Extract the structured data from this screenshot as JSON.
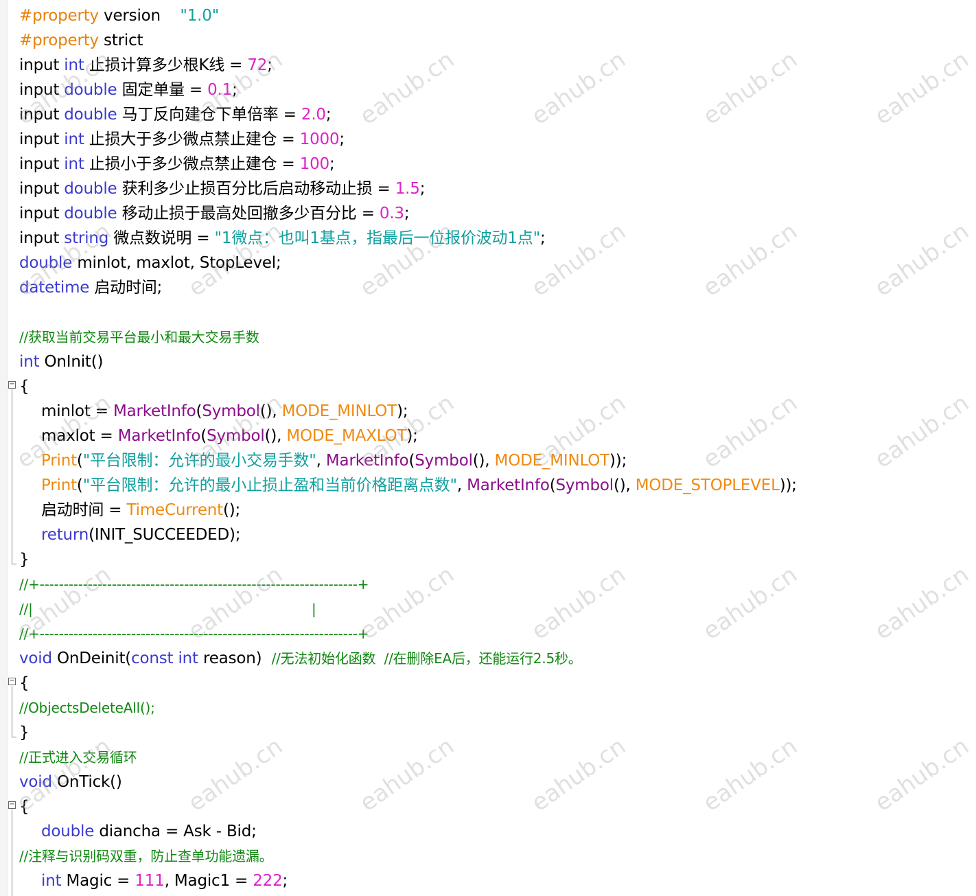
{
  "editor": {
    "watermark": "eahub.cn",
    "lines": [
      [
        {
          "t": "#property",
          "c": "pre"
        },
        {
          "t": " version    ",
          "c": "txt"
        },
        {
          "t": "\"1.0\"",
          "c": "str"
        }
      ],
      [
        {
          "t": "#property",
          "c": "pre"
        },
        {
          "t": " strict",
          "c": "txt"
        }
      ],
      [
        {
          "t": "input ",
          "c": "txt"
        },
        {
          "t": "int",
          "c": "kw"
        },
        {
          "t": " 止损计算多少根K线 = ",
          "c": "txt"
        },
        {
          "t": "72",
          "c": "num"
        },
        {
          "t": ";",
          "c": "txt"
        }
      ],
      [
        {
          "t": "input ",
          "c": "txt"
        },
        {
          "t": "double",
          "c": "kw"
        },
        {
          "t": " 固定单量 = ",
          "c": "txt"
        },
        {
          "t": "0.1",
          "c": "num"
        },
        {
          "t": ";",
          "c": "txt"
        }
      ],
      [
        {
          "t": "input ",
          "c": "txt"
        },
        {
          "t": "double",
          "c": "kw"
        },
        {
          "t": " 马丁反向建仓下单倍率 = ",
          "c": "txt"
        },
        {
          "t": "2.0",
          "c": "num"
        },
        {
          "t": ";",
          "c": "txt"
        }
      ],
      [
        {
          "t": "input ",
          "c": "txt"
        },
        {
          "t": "int",
          "c": "kw"
        },
        {
          "t": " 止损大于多少微点禁止建仓 = ",
          "c": "txt"
        },
        {
          "t": "1000",
          "c": "num"
        },
        {
          "t": ";",
          "c": "txt"
        }
      ],
      [
        {
          "t": "input ",
          "c": "txt"
        },
        {
          "t": "int",
          "c": "kw"
        },
        {
          "t": " 止损小于多少微点禁止建仓 = ",
          "c": "txt"
        },
        {
          "t": "100",
          "c": "num"
        },
        {
          "t": ";",
          "c": "txt"
        }
      ],
      [
        {
          "t": "input ",
          "c": "txt"
        },
        {
          "t": "double",
          "c": "kw"
        },
        {
          "t": " 获利多少止损百分比后启动移动止损 = ",
          "c": "txt"
        },
        {
          "t": "1.5",
          "c": "num"
        },
        {
          "t": ";",
          "c": "txt"
        }
      ],
      [
        {
          "t": "input ",
          "c": "txt"
        },
        {
          "t": "double",
          "c": "kw"
        },
        {
          "t": " 移动止损于最高处回撤多少百分比 = ",
          "c": "txt"
        },
        {
          "t": "0.3",
          "c": "num"
        },
        {
          "t": ";",
          "c": "txt"
        }
      ],
      [
        {
          "t": "input ",
          "c": "txt"
        },
        {
          "t": "string",
          "c": "kw"
        },
        {
          "t": " 微点数说明 = ",
          "c": "txt"
        },
        {
          "t": "\"1微点：也叫1基点，指最后一位报价波动1点\"",
          "c": "str"
        },
        {
          "t": ";",
          "c": "txt"
        }
      ],
      [
        {
          "t": "double",
          "c": "kw"
        },
        {
          "t": " minlot, maxlot, StopLevel;",
          "c": "txt"
        }
      ],
      [
        {
          "t": "datetime",
          "c": "kw"
        },
        {
          "t": " 启动时间;",
          "c": "txt"
        }
      ],
      [],
      [
        {
          "t": "//获取当前交易平台最小和最大交易手数",
          "c": "cmt",
          "small": true
        }
      ],
      [
        {
          "t": "int",
          "c": "kw"
        },
        {
          "t": " OnInit()",
          "c": "txt"
        }
      ],
      [
        {
          "t": "{",
          "c": "txt"
        }
      ],
      [
        {
          "t": "minlot = ",
          "c": "txt",
          "indent": true
        },
        {
          "t": "MarketInfo",
          "c": "fn"
        },
        {
          "t": "(",
          "c": "txt"
        },
        {
          "t": "Symbol",
          "c": "fn"
        },
        {
          "t": "(), ",
          "c": "txt"
        },
        {
          "t": "MODE_MINLOT",
          "c": "org"
        },
        {
          "t": ");",
          "c": "txt"
        }
      ],
      [
        {
          "t": "maxlot = ",
          "c": "txt",
          "indent": true
        },
        {
          "t": "MarketInfo",
          "c": "fn"
        },
        {
          "t": "(",
          "c": "txt"
        },
        {
          "t": "Symbol",
          "c": "fn"
        },
        {
          "t": "(), ",
          "c": "txt"
        },
        {
          "t": "MODE_MAXLOT",
          "c": "org"
        },
        {
          "t": ");",
          "c": "txt"
        }
      ],
      [
        {
          "t": "Print",
          "c": "org",
          "indent": true
        },
        {
          "t": "(",
          "c": "txt"
        },
        {
          "t": "\"平台限制：允许的最小交易手数\"",
          "c": "str"
        },
        {
          "t": ", ",
          "c": "txt"
        },
        {
          "t": "MarketInfo",
          "c": "fn"
        },
        {
          "t": "(",
          "c": "txt"
        },
        {
          "t": "Symbol",
          "c": "fn"
        },
        {
          "t": "(), ",
          "c": "txt"
        },
        {
          "t": "MODE_MINLOT",
          "c": "org"
        },
        {
          "t": "));",
          "c": "txt"
        }
      ],
      [
        {
          "t": "Print",
          "c": "org",
          "indent": true
        },
        {
          "t": "(",
          "c": "txt"
        },
        {
          "t": "\"平台限制：允许的最小止损止盈和当前价格距离点数\"",
          "c": "str"
        },
        {
          "t": ", ",
          "c": "txt"
        },
        {
          "t": "MarketInfo",
          "c": "fn"
        },
        {
          "t": "(",
          "c": "txt"
        },
        {
          "t": "Symbol",
          "c": "fn"
        },
        {
          "t": "(), ",
          "c": "txt"
        },
        {
          "t": "MODE_STOPLEVEL",
          "c": "org"
        },
        {
          "t": "));",
          "c": "txt"
        }
      ],
      [
        {
          "t": "启动时间 = ",
          "c": "txt",
          "indent": true
        },
        {
          "t": "TimeCurrent",
          "c": "org"
        },
        {
          "t": "();",
          "c": "txt"
        }
      ],
      [
        {
          "t": "return",
          "c": "kw",
          "indent": true
        },
        {
          "t": "(INIT_SUCCEEDED);",
          "c": "txt"
        }
      ],
      [
        {
          "t": "}",
          "c": "txt"
        }
      ],
      [
        {
          "t": "//+------------------------------------------------------------------+",
          "c": "cmt",
          "small": true
        }
      ],
      [
        {
          "t": "//|                                                                  |",
          "c": "cmt",
          "small": true
        }
      ],
      [
        {
          "t": "//+------------------------------------------------------------------+",
          "c": "cmt",
          "small": true
        }
      ],
      [
        {
          "t": "void",
          "c": "kw"
        },
        {
          "t": " OnDeinit(",
          "c": "txt"
        },
        {
          "t": "const int",
          "c": "kw"
        },
        {
          "t": " reason)  ",
          "c": "txt"
        },
        {
          "t": "//无法初始化函数  //在删除EA后，还能运行2.5秒。",
          "c": "cmt",
          "small": true
        }
      ],
      [
        {
          "t": "{",
          "c": "txt"
        }
      ],
      [
        {
          "t": "//ObjectsDeleteAll();",
          "c": "cmt",
          "small": true
        }
      ],
      [
        {
          "t": "}",
          "c": "txt"
        }
      ],
      [
        {
          "t": "//正式进入交易循环",
          "c": "cmt",
          "small": true
        }
      ],
      [
        {
          "t": "void",
          "c": "kw"
        },
        {
          "t": " OnTick()",
          "c": "txt"
        }
      ],
      [
        {
          "t": "{",
          "c": "txt"
        }
      ],
      [
        {
          "t": "double",
          "c": "kw",
          "indent": true
        },
        {
          "t": " diancha = Ask - Bid;",
          "c": "txt"
        }
      ],
      [
        {
          "t": "//注释与识别码双重，防止查单功能遗漏。",
          "c": "cmt",
          "small": true
        }
      ],
      [
        {
          "t": "int",
          "c": "kw",
          "indent": true
        },
        {
          "t": " Magic = ",
          "c": "txt"
        },
        {
          "t": "111",
          "c": "num"
        },
        {
          "t": ", Magic1 = ",
          "c": "txt"
        },
        {
          "t": "222",
          "c": "num"
        },
        {
          "t": ";",
          "c": "txt"
        }
      ]
    ]
  }
}
